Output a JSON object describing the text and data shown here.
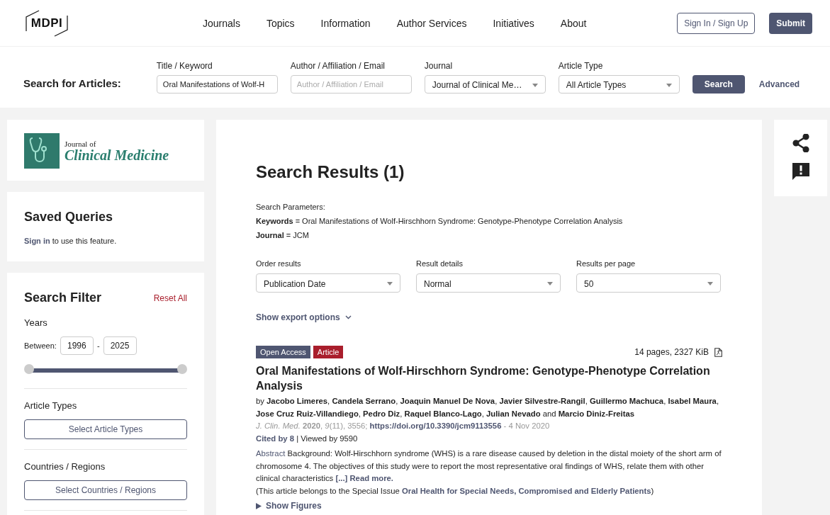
{
  "header": {
    "logo": "MDPI",
    "nav": [
      "Journals",
      "Topics",
      "Information",
      "Author Services",
      "Initiatives",
      "About"
    ],
    "sign_in": "Sign In / Sign Up",
    "submit": "Submit"
  },
  "search_bar": {
    "label": "Search for Articles:",
    "fields": [
      {
        "kind": "input",
        "label": "Title / Keyword",
        "value": "Oral Manifestations of Wolf-H"
      },
      {
        "kind": "input",
        "label": "Author / Affiliation / Email",
        "placeholder": "Author / Affiliation / Email"
      },
      {
        "kind": "select",
        "label": "Journal",
        "value": "Journal of Clinical Me…"
      },
      {
        "kind": "select",
        "label": "Article Type",
        "value": "All Article Types"
      }
    ],
    "search_button": "Search",
    "advanced": "Advanced"
  },
  "journal_logo": {
    "line1": "Journal of",
    "line2": "Clinical Medicine"
  },
  "saved_queries": {
    "title": "Saved Queries",
    "link": "Sign in",
    "text": " to use this feature."
  },
  "search_filter": {
    "title": "Search Filter",
    "reset": "Reset All",
    "years": {
      "label": "Years",
      "between": "Between:",
      "from": "1996",
      "dash": "-",
      "to": "2025",
      "slider": {
        "level": 1
      }
    },
    "sections": [
      {
        "title": "Article Types",
        "button": "Select Article Types"
      },
      {
        "title": "Countries / Regions",
        "button": "Select Countries / Regions"
      }
    ]
  },
  "results": {
    "title": "Search Results (1)",
    "params_label": "Search Parameters:",
    "params": [
      "**Keywords** = Oral Manifestations of Wolf-Hirschhorn Syndrome: Genotype-Phenotype Correlation Analysis",
      "**Journal** = JCM"
    ],
    "controls": [
      {
        "label": "Order results",
        "value": "Publication Date"
      },
      {
        "label": "Result details",
        "value": "Normal"
      },
      {
        "label": "Results per page",
        "value": "50"
      }
    ],
    "export": "Show export options"
  },
  "article": {
    "badges": [
      {
        "text": "Open Access",
        "color": "#4f5671"
      },
      {
        "text": "Article",
        "color": "#a91e2c"
      }
    ],
    "size": "14 pages, 2327 KiB",
    "title": "Oral Manifestations of Wolf-Hirschhorn Syndrome: Genotype-Phenotype Correlation Analysis",
    "authors": "by **Jacobo Limeres**, **Candela Serrano**, **Joaquin Manuel De Nova**, **Javier Silvestre-Rangil**, **Guillermo Machuca**, **Isabel Maura**, **Jose Cruz Ruiz-Villandiego**, **Pedro Diz**, **Raquel Blanco-Lago**, **Julian Nevado** and **Marcio Diniz-Freitas**",
    "citation": "*J. Clin. Med.* **2020**, *9*(11), 3556; ",
    "doi": "https://doi.org/10.3390/jcm9113556",
    "date": " - 4 Nov 2020",
    "cited": "Cited by 8",
    "viewed": " | Viewed by 9590",
    "abstract_label": "Abstract",
    "abstract": " Background: Wolf-Hirschhorn syndrome (WHS) is a rare disease caused by deletion in the distal moiety of the short arm of chromosome 4. The objectives of this study were to report the most representative oral findings of WHS, relate them with other clinical characteristics ",
    "read_more": "[...] Read more.",
    "special_prefix": "(This article belongs to the Special Issue ",
    "special_link": "Oral Health for Special Needs, Compromised and Elderly Patients",
    "special_suffix": ")",
    "show_figures": "Show Figures"
  }
}
